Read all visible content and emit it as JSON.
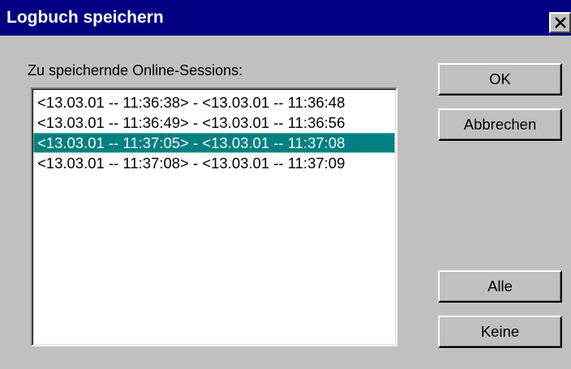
{
  "window": {
    "title": "Logbuch speichern",
    "close_icon": "close-icon"
  },
  "sessions": {
    "label": "Zu speichernde Online-Sessions:",
    "items": [
      "<13.03.01 -- 11:36:38> - <13.03.01 -- 11:36:48",
      "<13.03.01 -- 11:36:49> - <13.03.01 -- 11:36:56",
      "<13.03.01 -- 11:37:05> - <13.03.01 -- 11:37:08",
      "<13.03.01 -- 11:37:08> - <13.03.01 -- 11:37:09"
    ],
    "selected_index": 2
  },
  "buttons": {
    "ok": "OK",
    "cancel": "Abbrechen",
    "all": "Alle",
    "none": "Keine"
  },
  "colors": {
    "titlebar": "#000080",
    "selection": "#008080",
    "face": "#c0c0c0"
  }
}
